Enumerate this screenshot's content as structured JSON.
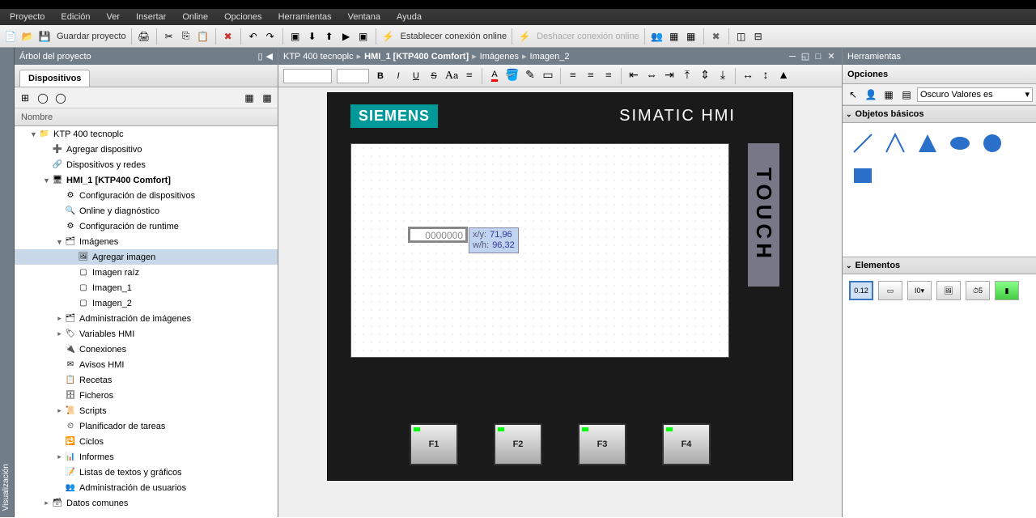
{
  "menu": [
    "Proyecto",
    "Edición",
    "Ver",
    "Insertar",
    "Online",
    "Opciones",
    "Herramientas",
    "Ventana",
    "Ayuda"
  ],
  "toolbar": {
    "save_project": "Guardar proyecto",
    "go_online": "Establecer conexión online",
    "go_offline": "Deshacer conexión online"
  },
  "sidebar_handle": "Visualización",
  "project_tree": {
    "title": "Árbol del proyecto",
    "tab": "Dispositivos",
    "column": "Nombre",
    "items": [
      {
        "ind": 1,
        "exp": "▼",
        "icon": "project",
        "label": "KTP 400 tecnoplc"
      },
      {
        "ind": 2,
        "exp": "",
        "icon": "add",
        "label": "Agregar dispositivo"
      },
      {
        "ind": 2,
        "exp": "",
        "icon": "net",
        "label": "Dispositivos y redes"
      },
      {
        "ind": 2,
        "exp": "▼",
        "icon": "hmi",
        "label": "HMI_1 [KTP400 Comfort]",
        "bold": true
      },
      {
        "ind": 3,
        "exp": "",
        "icon": "cfg",
        "label": "Configuración de dispositivos"
      },
      {
        "ind": 3,
        "exp": "",
        "icon": "diag",
        "label": "Online y diagnóstico"
      },
      {
        "ind": 3,
        "exp": "",
        "icon": "rt",
        "label": "Configuración de runtime"
      },
      {
        "ind": 3,
        "exp": "▼",
        "icon": "folder",
        "label": "Imágenes"
      },
      {
        "ind": 4,
        "exp": "",
        "icon": "addimg",
        "label": "Agregar imagen",
        "selected": true
      },
      {
        "ind": 4,
        "exp": "",
        "icon": "img",
        "label": "Imagen raíz"
      },
      {
        "ind": 4,
        "exp": "",
        "icon": "img",
        "label": "Imagen_1"
      },
      {
        "ind": 4,
        "exp": "",
        "icon": "img",
        "label": "Imagen_2"
      },
      {
        "ind": 3,
        "exp": "▸",
        "icon": "folder",
        "label": "Administración de imágenes"
      },
      {
        "ind": 3,
        "exp": "▸",
        "icon": "tags",
        "label": "Variables HMI"
      },
      {
        "ind": 3,
        "exp": "",
        "icon": "conn",
        "label": "Conexiones"
      },
      {
        "ind": 3,
        "exp": "",
        "icon": "alarm",
        "label": "Avisos HMI"
      },
      {
        "ind": 3,
        "exp": "",
        "icon": "recipe",
        "label": "Recetas"
      },
      {
        "ind": 3,
        "exp": "",
        "icon": "log",
        "label": "Ficheros"
      },
      {
        "ind": 3,
        "exp": "▸",
        "icon": "script",
        "label": "Scripts"
      },
      {
        "ind": 3,
        "exp": "",
        "icon": "sched",
        "label": "Planificador de tareas"
      },
      {
        "ind": 3,
        "exp": "",
        "icon": "cycle",
        "label": "Ciclos"
      },
      {
        "ind": 3,
        "exp": "▸",
        "icon": "report",
        "label": "Informes"
      },
      {
        "ind": 3,
        "exp": "",
        "icon": "txt",
        "label": "Listas de textos y gráficos"
      },
      {
        "ind": 3,
        "exp": "",
        "icon": "user",
        "label": "Administración de usuarios"
      },
      {
        "ind": 2,
        "exp": "▸",
        "icon": "common",
        "label": "Datos comunes"
      }
    ]
  },
  "breadcrumb": [
    "KTP 400 tecnoplc",
    "HMI_1 [KTP400 Comfort]",
    "Imágenes",
    "Imagen_2"
  ],
  "hmi": {
    "brand": "SIEMENS",
    "product": "SIMATIC HMI",
    "touch": "TOUCH",
    "io_value": "0000000",
    "tooltip": {
      "xy_label": "x/y:",
      "xy_val": "71,96",
      "wh_label": "w/h:",
      "wh_val": "96,32"
    },
    "fkeys": [
      "F1",
      "F2",
      "F3",
      "F4"
    ]
  },
  "tools": {
    "title": "Herramientas",
    "options": "Opciones",
    "combo": "Oscuro Valores es",
    "basic_objects": "Objetos básicos",
    "elements": "Elementos",
    "elem_num": "0.12",
    "elem_io": "I0▾"
  }
}
